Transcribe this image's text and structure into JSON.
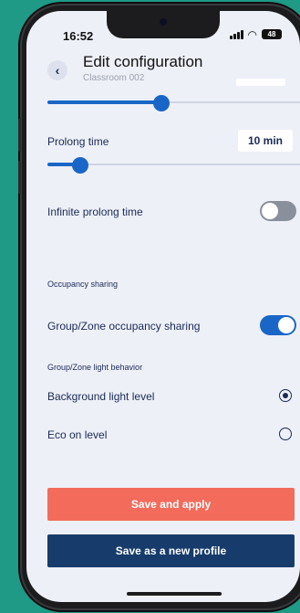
{
  "status": {
    "time": "16:52",
    "battery": "48"
  },
  "header": {
    "title": "Edit configuration",
    "subtitle": "Classroom 002",
    "back": "‹"
  },
  "sliders": {
    "top_level": 0.45,
    "prolong_time": 0.13
  },
  "settings": {
    "prolong_time_label": "Prolong time",
    "prolong_time_value": "10 min",
    "infinite_prolong_label": "Infinite prolong time",
    "infinite_prolong_on": false
  },
  "occupancy": {
    "section_label": "Occupancy sharing",
    "group_sharing_label": "Group/Zone occupancy sharing",
    "group_sharing_on": true,
    "behavior_label": "Group/Zone light behavior",
    "options": [
      {
        "label": "Background light level",
        "selected": true
      },
      {
        "label": "Eco on level",
        "selected": false
      }
    ]
  },
  "actions": {
    "apply": "Save and apply",
    "new_profile": "Save as a new profile"
  },
  "colors": {
    "accent": "#1a66c6",
    "apply": "#f26b5b",
    "profile": "#173c6b",
    "background": "#1f9a86"
  }
}
